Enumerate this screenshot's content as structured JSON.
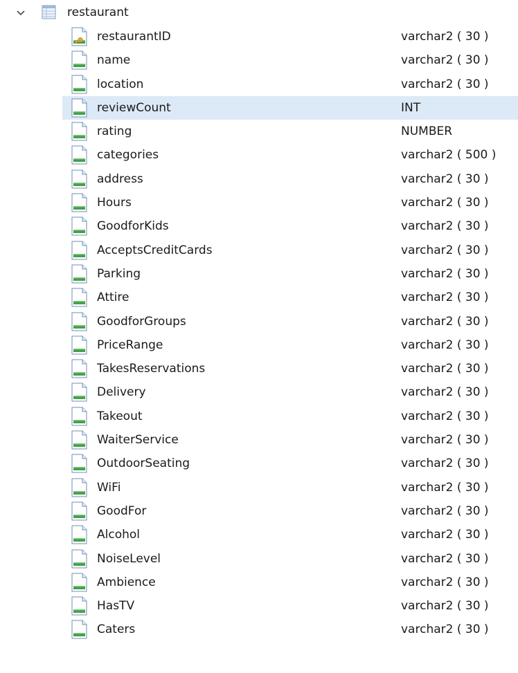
{
  "table": {
    "name": "restaurant",
    "expanded": true,
    "columns": [
      {
        "name": "restaurantID",
        "type": "varchar2 ( 30 )",
        "icon": "primary-key-column-icon"
      },
      {
        "name": "name",
        "type": "varchar2 ( 30 )",
        "icon": "column-icon"
      },
      {
        "name": "location",
        "type": "varchar2 ( 30 )",
        "icon": "column-icon"
      },
      {
        "name": "reviewCount",
        "type": "INT",
        "icon": "column-icon",
        "selected": true
      },
      {
        "name": "rating",
        "type": "NUMBER",
        "icon": "column-icon"
      },
      {
        "name": "categories",
        "type": "varchar2 ( 500 )",
        "icon": "column-icon"
      },
      {
        "name": "address",
        "type": "varchar2 ( 30 )",
        "icon": "column-icon"
      },
      {
        "name": "Hours",
        "type": "varchar2 ( 30 )",
        "icon": "column-icon"
      },
      {
        "name": "GoodforKids",
        "type": "varchar2 ( 30 )",
        "icon": "column-icon"
      },
      {
        "name": "AcceptsCreditCards",
        "type": "varchar2 ( 30 )",
        "icon": "column-icon"
      },
      {
        "name": "Parking",
        "type": "varchar2 ( 30 )",
        "icon": "column-icon"
      },
      {
        "name": "Attire",
        "type": "varchar2 ( 30 )",
        "icon": "column-icon"
      },
      {
        "name": "GoodforGroups",
        "type": "varchar2 ( 30 )",
        "icon": "column-icon"
      },
      {
        "name": "PriceRange",
        "type": "varchar2 ( 30 )",
        "icon": "column-icon"
      },
      {
        "name": "TakesReservations",
        "type": "varchar2 ( 30 )",
        "icon": "column-icon"
      },
      {
        "name": "Delivery",
        "type": "varchar2 ( 30 )",
        "icon": "column-icon"
      },
      {
        "name": "Takeout",
        "type": "varchar2 ( 30 )",
        "icon": "column-icon"
      },
      {
        "name": "WaiterService",
        "type": "varchar2 ( 30 )",
        "icon": "column-icon"
      },
      {
        "name": "OutdoorSeating",
        "type": "varchar2 ( 30 )",
        "icon": "column-icon"
      },
      {
        "name": "WiFi",
        "type": "varchar2 ( 30 )",
        "icon": "column-icon"
      },
      {
        "name": "GoodFor",
        "type": "varchar2 ( 30 )",
        "icon": "column-icon"
      },
      {
        "name": "Alcohol",
        "type": "varchar2 ( 30 )",
        "icon": "column-icon"
      },
      {
        "name": "NoiseLevel",
        "type": "varchar2 ( 30 )",
        "icon": "column-icon"
      },
      {
        "name": "Ambience",
        "type": "varchar2 ( 30 )",
        "icon": "column-icon"
      },
      {
        "name": "HasTV",
        "type": "varchar2 ( 30 )",
        "icon": "column-icon"
      },
      {
        "name": "Caters",
        "type": "varchar2 ( 30 )",
        "icon": "column-icon"
      }
    ]
  },
  "colors": {
    "selection": "#dce9f6",
    "icon_green": "#3a9d3a",
    "icon_border": "#5a7fa8",
    "key_gold": "#d6a21e"
  }
}
